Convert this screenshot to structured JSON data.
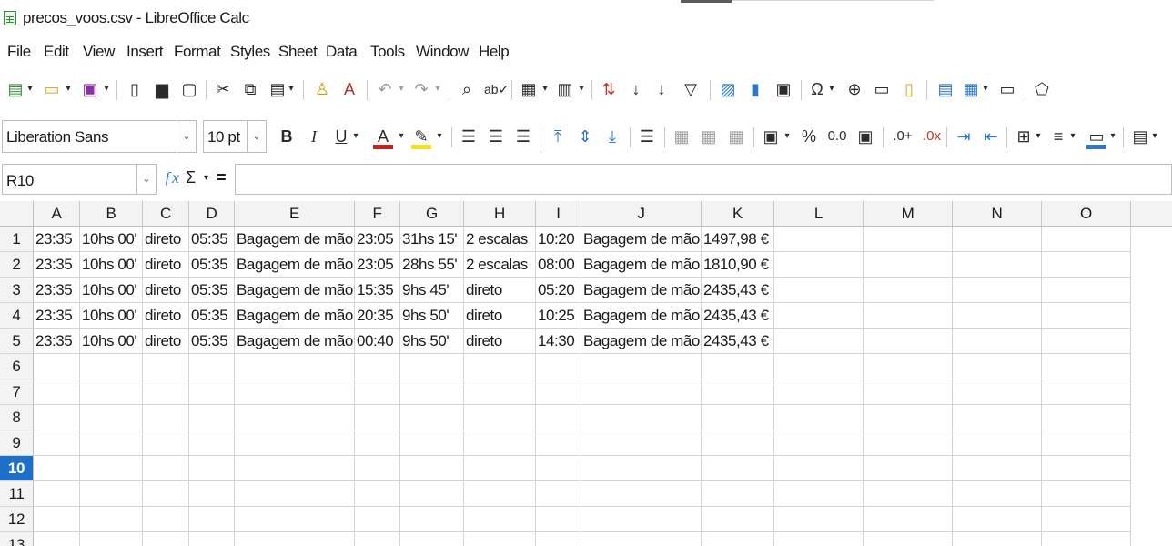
{
  "window": {
    "title": "precos_voos.csv - LibreOffice Calc"
  },
  "menu": [
    "File",
    "Edit",
    "View",
    "Insert",
    "Format",
    "Styles",
    "Sheet",
    "Data",
    "Tools",
    "Window",
    "Help"
  ],
  "toolbar": {
    "font_name": "Liberation Sans",
    "font_size": "10 pt",
    "percent_label": "%",
    "decimal_label": "0.0"
  },
  "formula_bar": {
    "cell_ref": "R10",
    "formula": ""
  },
  "sheet": {
    "columns": [
      "A",
      "B",
      "C",
      "D",
      "E",
      "F",
      "G",
      "H",
      "I",
      "J",
      "K",
      "L",
      "M",
      "N",
      "O"
    ],
    "rows": [
      "1",
      "2",
      "3",
      "4",
      "5",
      "6",
      "7",
      "8",
      "9",
      "10",
      "11",
      "12",
      "13"
    ],
    "active_row": "10",
    "data": [
      [
        "23:35",
        "10hs 00'",
        "direto",
        "05:35",
        "Bagagem de mão",
        "23:05",
        "31hs 15'",
        "2 escalas",
        "10:20",
        "Bagagem de mão",
        "1497,98 €"
      ],
      [
        "23:35",
        "10hs 00'",
        "direto",
        "05:35",
        "Bagagem de mão",
        "23:05",
        "28hs 55'",
        "2 escalas",
        "08:00",
        "Bagagem de mão",
        "1810,90 €"
      ],
      [
        "23:35",
        "10hs 00'",
        "direto",
        "05:35",
        "Bagagem de mão",
        "15:35",
        "9hs 45'",
        "direto",
        "05:20",
        "Bagagem de mão",
        "2435,43 €"
      ],
      [
        "23:35",
        "10hs 00'",
        "direto",
        "05:35",
        "Bagagem de mão",
        "20:35",
        "9hs 50'",
        "direto",
        "10:25",
        "Bagagem de mão",
        "2435,43 €"
      ],
      [
        "23:35",
        "10hs 00'",
        "direto",
        "05:35",
        "Bagagem de mão",
        "00:40",
        "9hs 50'",
        "direto",
        "14:30",
        "Bagagem de mão",
        "2435,43 €"
      ]
    ]
  },
  "icons": [
    "new-document-icon",
    "open-folder-icon",
    "save-icon",
    "export-pdf-icon",
    "print-icon",
    "print-preview-icon",
    "cut-icon",
    "copy-icon",
    "paste-icon",
    "clone-format-icon",
    "clear-format-icon",
    "undo-icon",
    "redo-icon",
    "find-replace-icon",
    "spelling-icon",
    "row-icon",
    "column-icon",
    "sort-icon",
    "sort-ascending-icon",
    "sort-descending-icon",
    "autofilter-icon",
    "image-icon",
    "chart-icon",
    "pivot-table-icon",
    "special-character-icon",
    "hyperlink-icon",
    "comment-icon",
    "headers-footers-icon",
    "define-print-area-icon",
    "freeze-rows-icon",
    "split-window-icon",
    "show-draw-functions-icon",
    "bold-icon",
    "italic-icon",
    "underline-icon",
    "font-color-icon",
    "highlight-color-icon",
    "align-left-icon",
    "align-center-icon",
    "align-right-icon",
    "align-top-icon",
    "align-middle-icon",
    "align-bottom-icon",
    "wrap-text-icon",
    "merge-center-icon",
    "merge-cells-icon",
    "unmerge-cells-icon",
    "currency-icon",
    "percent-icon",
    "number-format-icon",
    "date-icon",
    "add-decimal-icon",
    "delete-decimal-icon",
    "increase-indent-icon",
    "decrease-indent-icon",
    "borders-icon",
    "border-style-icon",
    "border-color-icon",
    "conditional-format-icon",
    "function-wizard-icon",
    "sum-icon",
    "equals-icon"
  ]
}
